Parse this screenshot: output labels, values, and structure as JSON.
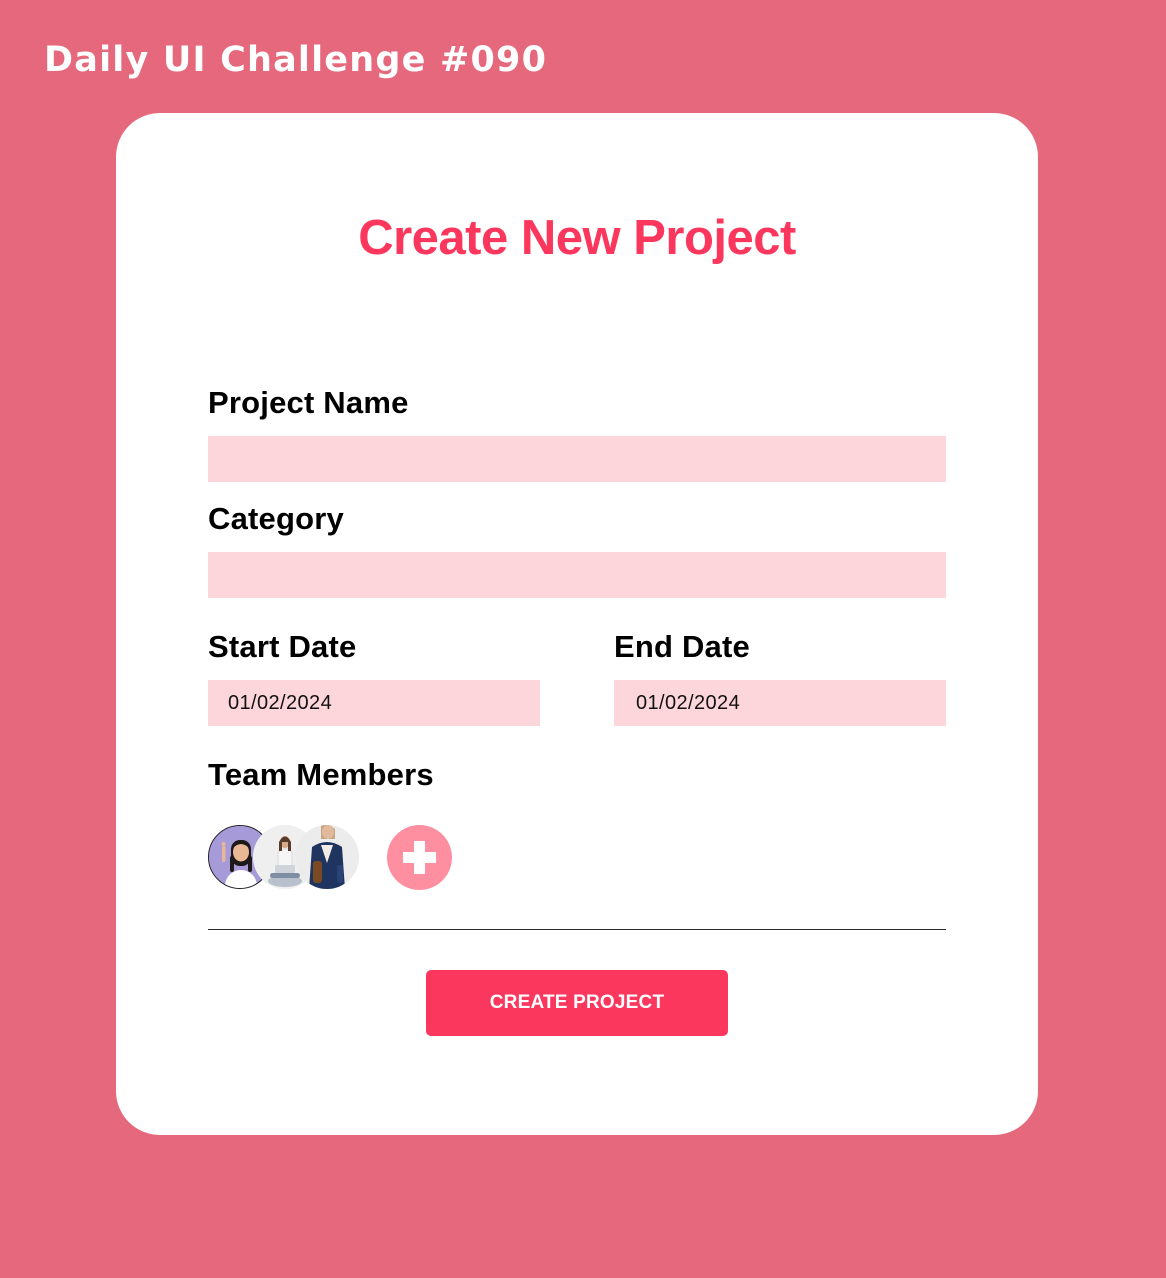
{
  "header": {
    "challenge_title": "Daily UI Challenge #090"
  },
  "form": {
    "title": "Create New Project",
    "project_name": {
      "label": "Project Name",
      "value": "",
      "placeholder": ""
    },
    "category": {
      "label": "Category",
      "value": "",
      "placeholder": ""
    },
    "start_date": {
      "label": "Start Date",
      "value": "01/02/2024"
    },
    "end_date": {
      "label": "End Date",
      "value": "01/02/2024"
    },
    "team_members": {
      "label": "Team Members",
      "members": [
        {
          "avatar": "girl-purple-background"
        },
        {
          "avatar": "woman-sitting-laptop"
        },
        {
          "avatar": "woman-navy-blazer"
        }
      ],
      "add_icon": "plus-icon"
    },
    "submit_label": "CREATE PROJECT"
  },
  "colors": {
    "background": "#e5687c",
    "accent": "#fb375e",
    "field_fill": "#fdd6dc",
    "add_button": "#fd8fa1"
  }
}
